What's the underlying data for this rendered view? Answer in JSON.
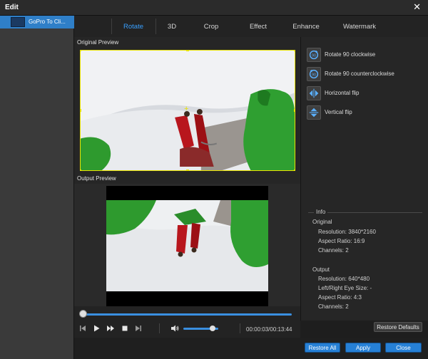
{
  "window": {
    "title": "Edit"
  },
  "sidebar": {
    "items": [
      {
        "label": "GoPro To Cli..."
      }
    ]
  },
  "tabs": [
    {
      "label": "Rotate",
      "active": true
    },
    {
      "label": "3D",
      "active": false
    },
    {
      "label": "Crop",
      "active": false
    },
    {
      "label": "Effect",
      "active": false
    },
    {
      "label": "Enhance",
      "active": false
    },
    {
      "label": "Watermark",
      "active": false
    }
  ],
  "preview": {
    "original_label": "Original Preview",
    "output_label": "Output Preview"
  },
  "actions": [
    {
      "label": "Rotate 90 clockwise",
      "icon": "rotate-clockwise-icon"
    },
    {
      "label": "Rotate 90 counterclockwise",
      "icon": "rotate-counterclockwise-icon"
    },
    {
      "label": "Horizontal flip",
      "icon": "horizontal-flip-icon"
    },
    {
      "label": "Vertical flip",
      "icon": "vertical-flip-icon"
    }
  ],
  "info": {
    "title": "Info",
    "original": {
      "heading": "Original",
      "resolution": "Resolution: 3840*2160",
      "aspect_ratio": "Aspect Ratio: 16:9",
      "channels": "Channels: 2"
    },
    "output": {
      "heading": "Output",
      "resolution": "Resolution: 640*480",
      "eye_size": "Left/Right Eye Size: -",
      "aspect_ratio": "Aspect Ratio: 4:3",
      "channels": "Channels: 2"
    }
  },
  "player": {
    "timecode": "00:00:03/00:13:44",
    "progress_fraction": 0.0,
    "volume_fraction": 0.9
  },
  "buttons": {
    "restore_defaults": "Restore Defaults",
    "restore_all": "Restore All",
    "apply": "Apply",
    "close": "Close"
  },
  "colors": {
    "accent": "#2680d6",
    "active_tab": "#39a0ff",
    "crop_border": "#e8e200",
    "selected_item": "#2f7fc8"
  }
}
